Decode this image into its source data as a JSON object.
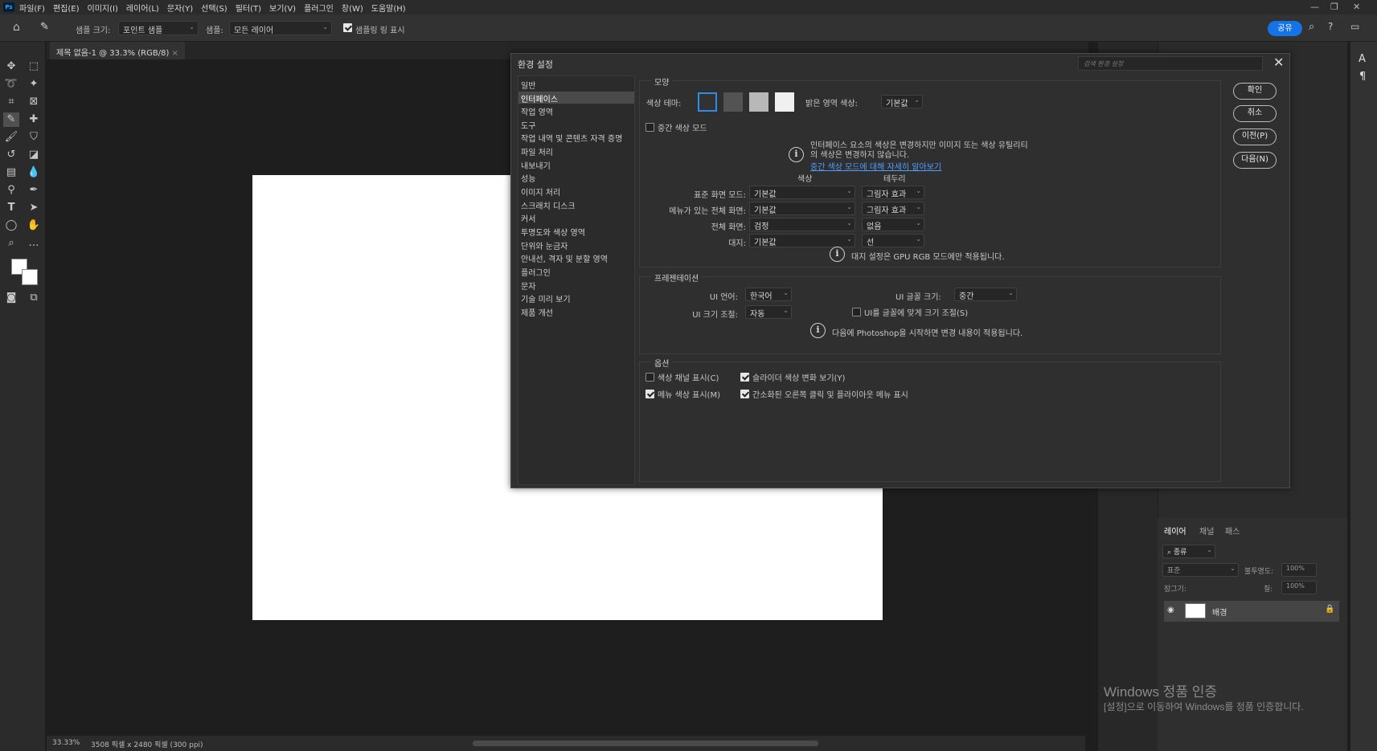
{
  "menubar": {
    "logo": "Ps",
    "items": [
      "파일(F)",
      "편집(E)",
      "이미지(I)",
      "레이어(L)",
      "문자(Y)",
      "선택(S)",
      "필터(T)",
      "보기(V)",
      "플러그인",
      "창(W)",
      "도움말(H)"
    ]
  },
  "options": {
    "sample_size_label": "샘플 크기:",
    "sample_size_value": "포인트 샘플",
    "sample_label": "샘플:",
    "sample_value": "모든 레이어",
    "show_ring_label": "샘플링 링 표시",
    "share_label": "공유"
  },
  "document": {
    "tab_title": "제목 없음-1 @ 33.3% (RGB/8)",
    "zoom": "33.33%",
    "size_info": "3508 픽셀 x 2480 픽셀 (300 ppi)"
  },
  "dialog": {
    "title": "환경 설정",
    "search_placeholder": "검색 환경 설정",
    "nav": [
      "일반",
      "인터페이스",
      "작업 영역",
      "도구",
      "작업 내역 및 콘텐츠 자격 증명",
      "파일 처리",
      "내보내기",
      "성능",
      "이미지 처리",
      "스크래치 디스크",
      "커서",
      "투명도와 색상 영역",
      "단위와 눈금자",
      "안내선, 격자 및 분할 영역",
      "플러그인",
      "문자",
      "기술 미리 보기",
      "제품 개선"
    ],
    "active_nav": "인터페이스",
    "appearance": {
      "title": "모양",
      "color_theme_label": "색상 테마:",
      "highlight_label": "밝은 영역 색상:",
      "highlight_value": "기본값",
      "mid_color_mode": "중간 색상 모드",
      "info_text_1": "인터페이스 요소의 색상은 변경하지만 이미지 또는 색상 유틸리티",
      "info_text_2": "의 색상은 변경하지 않습니다.",
      "info_link": "중간 색상 모드에 대해 자세히 알아보기",
      "col_color": "색상",
      "col_border": "테두리",
      "rows": [
        {
          "label": "표준 화면 모드:",
          "color": "기본값",
          "border": "그림자 효과"
        },
        {
          "label": "메뉴가 있는 전체 화면:",
          "color": "기본값",
          "border": "그림자 효과"
        },
        {
          "label": "전체 화면:",
          "color": "검정",
          "border": "없음"
        },
        {
          "label": "대지:",
          "color": "기본값",
          "border": "선"
        }
      ],
      "artboard_note": "대지 설정은 GPU RGB 모드에만 적용됩니다.",
      "theme_colors": [
        "#323232",
        "#535353",
        "#b8b8b8",
        "#f0f0f0"
      ]
    },
    "presentation": {
      "title": "프레젠테이션",
      "ui_lang_label": "UI 언어:",
      "ui_lang_value": "한국어",
      "ui_font_label": "UI 글꼴 크기:",
      "ui_font_value": "중간",
      "ui_scale_label": "UI 크기 조절:",
      "ui_scale_value": "자동",
      "scale_to_font": "UI를 글꼴에 맞게 크기 조절(S)",
      "restart_note": "다음에 Photoshop을 시작하면 변경 내용이 적용됩니다."
    },
    "options": {
      "title": "옵션",
      "show_channels": "색상 채널 표시(C)",
      "show_slider_color": "슬라이더 색상 변화 보기(Y)",
      "show_menu_colors": "메뉴 색상 표시(M)",
      "simplified_menu": "간소화된 오른쪽 클릭 및 플라이아웃 메뉴 표시"
    },
    "buttons": {
      "ok": "확인",
      "cancel": "취소",
      "prev": "이전(P)",
      "next": "다음(N)"
    }
  },
  "layers": {
    "tabs": [
      "레이어",
      "채널",
      "패스"
    ],
    "filter_label": "종류",
    "blend_mode": "표준",
    "opacity_label": "불투명도:",
    "opacity_value": "100%",
    "lock_label": "잠그기:",
    "fill_label": "칠:",
    "fill_value": "100%",
    "layer_name": "배경"
  },
  "activation": {
    "title": "Windows 정품 인증",
    "message": "[설정]으로 이동하여 Windows를 정품 인증합니다."
  }
}
